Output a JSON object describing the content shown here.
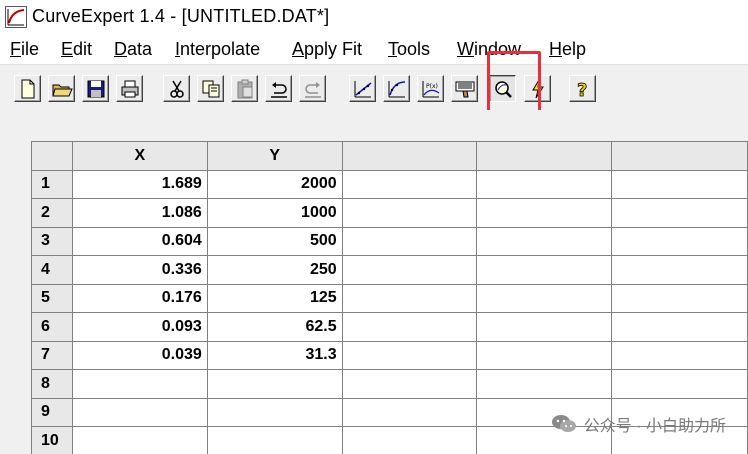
{
  "window": {
    "title": "CurveExpert 1.4 - [UNTITLED.DAT*]",
    "app_icon": "curve-app-icon"
  },
  "menu": [
    {
      "mnemonic": "F",
      "rest": "ile"
    },
    {
      "mnemonic": "E",
      "rest": "dit"
    },
    {
      "mnemonic": "D",
      "rest": "ata"
    },
    {
      "mnemonic": "I",
      "rest": "nterpolate"
    },
    {
      "mnemonic": "A",
      "rest": "pply Fit"
    },
    {
      "mnemonic": "T",
      "rest": "ools"
    },
    {
      "mnemonic": "W",
      "rest": "indow"
    },
    {
      "mnemonic": "H",
      "rest": "elp"
    }
  ],
  "toolbar": {
    "buttons": [
      "new-file-icon",
      "open-folder-icon",
      "save-icon",
      "print-icon",
      "cut-icon",
      "copy-icon",
      "paste-icon",
      "undo-icon",
      "redo-icon",
      "linear-regression-icon",
      "nonlinear-regression-icon",
      "polynomial-icon",
      "interpolation-icon",
      "curve-finder-icon",
      "calculate-icon",
      "help-icon"
    ],
    "highlight_color": "#e8303a"
  },
  "grid": {
    "columns": [
      "X",
      "Y",
      "",
      "",
      ""
    ],
    "rows": [
      {
        "n": "1",
        "x": "1.689",
        "y": "2000"
      },
      {
        "n": "2",
        "x": "1.086",
        "y": "1000"
      },
      {
        "n": "3",
        "x": "0.604",
        "y": "500"
      },
      {
        "n": "4",
        "x": "0.336",
        "y": "250"
      },
      {
        "n": "5",
        "x": "0.176",
        "y": "125"
      },
      {
        "n": "6",
        "x": "0.093",
        "y": "62.5"
      },
      {
        "n": "7",
        "x": "0.039",
        "y": "31.3"
      },
      {
        "n": "8",
        "x": "",
        "y": ""
      },
      {
        "n": "9",
        "x": "",
        "y": ""
      },
      {
        "n": "10",
        "x": "",
        "y": ""
      }
    ]
  },
  "watermark": {
    "text": "公众号 · 小白助力所"
  }
}
